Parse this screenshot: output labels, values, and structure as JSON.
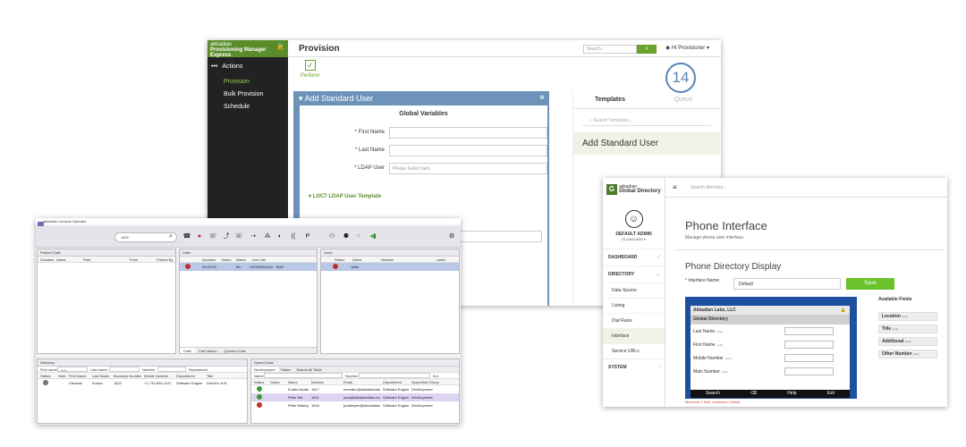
{
  "provisioning": {
    "brand_top": "akkadian",
    "brand_bottom": "Provisioning Manager Express",
    "actions_label": "Actions",
    "nav": [
      "Provision",
      "Bulk Provision",
      "Schedule"
    ],
    "page_title": "Provision",
    "search_placeholder": "Search...",
    "user_menu": "Hi Provisioner",
    "perform_label": "Perform",
    "panel_title": "Add Standard User",
    "global_vars_title": "Global Variables",
    "fields": [
      {
        "label": "* First Name",
        "value": ""
      },
      {
        "label": "* Last Name",
        "value": ""
      },
      {
        "label": "* LDAP User",
        "value": "Please Select Item"
      }
    ],
    "section_ldap_template": "LOC7 LDAP User Template",
    "templates_tab": "Templates",
    "queue_tab": "Queue",
    "templates_search_placeholder": "Search Templates...",
    "template_item": "Add Standard User",
    "badge_number": "14"
  },
  "console": {
    "title": "akkadian Console Operator",
    "dial_value": "1822",
    "panels": {
      "parked": {
        "title": "Parked Calls",
        "columns": [
          "Duration",
          "Notes",
          "Park",
          "From",
          "Parked By"
        ]
      },
      "calls": {
        "title": "Calls",
        "columns": [
          "",
          "Duration",
          "Notes",
          "Name",
          "Line Info"
        ],
        "row": [
          "",
          "00:00:03",
          "",
          "Bo...",
          "+16762501240",
          "1666"
        ]
      },
      "lines": {
        "title": "Lines",
        "columns": [
          "",
          "Status",
          "Notes",
          "Number",
          "Label"
        ],
        "row": [
          "",
          "1666"
        ]
      },
      "calls_tabs": [
        "Calls",
        "Call History",
        "Queued Calls"
      ],
      "directory": {
        "title": "Directory",
        "filters": [
          "First name:",
          "Last name:",
          "Number",
          "Department"
        ],
        "filter_first_value": "rich",
        "columns": [
          "Status",
          "Notes",
          "First Name",
          "Last Name",
          "Business Number",
          "Mobile Number",
          "Department",
          "Title"
        ],
        "rows": [
          [
            "",
            "",
            "Vishwas",
            "Kumar",
            "1822",
            "+1-732-625-1417",
            "Software Engine",
            "Director of N"
          ]
        ]
      },
      "speed": {
        "title": "Speed Dials",
        "tabs": [
          "Development",
          "Tables",
          "Search All Table"
        ],
        "filters": [
          "Name",
          "Number",
          "ALL"
        ],
        "columns": [
          "Status",
          "Notes",
          "Name",
          "Number",
          "Email",
          "Department",
          "SpeedDial Group"
        ],
        "rows": [
          [
            "",
            "",
            "Evatin Morales",
            "1817",
            "emmahu@akkadianlabs.com",
            "Software Engineering",
            "Development"
          ],
          [
            "",
            "",
            "Peter Ma",
            "1821",
            "pma@akkadianlabs.com",
            "Software Engineering",
            "Development"
          ],
          [
            "",
            "",
            "Peter Makeyer",
            "1816",
            "pmakeyev@akkadianlabs...",
            "Software Engineering",
            "Development"
          ]
        ],
        "row_status_colors": [
          "#3a9a3a",
          "#3a9a3a",
          "#c0302a"
        ]
      }
    }
  },
  "directory_app": {
    "brand_top": "akkadian",
    "brand_bottom": "Global Directory",
    "search_placeholder": "Search directory...",
    "user_name": "DEFAULT ADMIN",
    "user_role": "GLOBADMIN",
    "menu": {
      "dashboard": "DASHBOARD",
      "directory": "DIRECTORY",
      "sub": [
        "Data Source",
        "Listing",
        "Dial Rules",
        "Interface",
        "Service URLs"
      ],
      "system": "SYSTEM"
    },
    "page_title": "Phone Interface",
    "page_subtitle": "Manage phone user interface",
    "section_title": "Phone Directory Display",
    "interface_name_label": "* Interface Name:",
    "interface_name_value": "Default",
    "save_label": "Save",
    "phone": {
      "header": "Akkadian Labs, LLC",
      "group": "Global Directory",
      "rows": [
        {
          "label": "Last Name",
          "hint": "[edit]"
        },
        {
          "label": "First Name",
          "hint": "[edit]"
        },
        {
          "label": "Mobile Number",
          "hint": "[edit]"
        },
        {
          "label": "Main Number",
          "hint": "[edit]"
        }
      ],
      "softkeys": [
        "Search",
        "⌫",
        "Help",
        "Exit"
      ]
    },
    "field_limit_note": "Minimum 1 field, maximum 4 fields",
    "available_title": "Available Fields",
    "available": [
      {
        "label": "Location",
        "hint": "[edit]"
      },
      {
        "label": "Title",
        "hint": "[edit]"
      },
      {
        "label": "Additional",
        "hint": "[edit]"
      },
      {
        "label": "Other Number",
        "hint": "[edit]"
      }
    ]
  }
}
